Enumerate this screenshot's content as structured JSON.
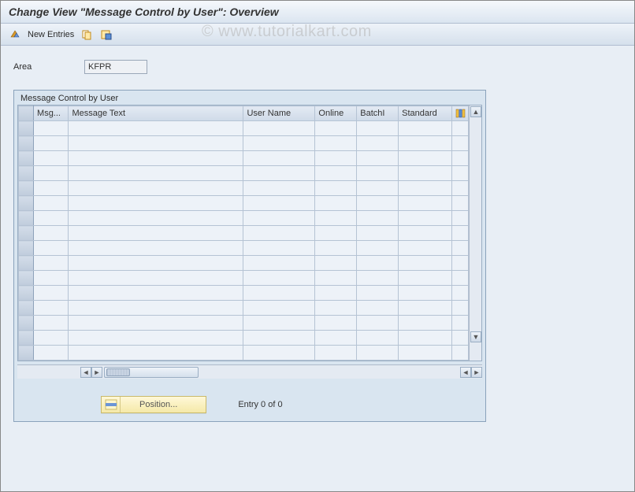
{
  "title": "Change View \"Message Control by User\": Overview",
  "watermark": "© www.tutorialkart.com",
  "toolbar": {
    "new_entries_label": "New Entries"
  },
  "area_field": {
    "label": "Area",
    "value": "KFPR"
  },
  "panel": {
    "title": "Message Control by User",
    "columns": [
      "Msg...",
      "Message Text",
      "User Name",
      "Online",
      "BatchI",
      "Standard"
    ],
    "row_count": 16
  },
  "footer": {
    "position_label": "Position...",
    "entry_text": "Entry 0 of 0"
  }
}
